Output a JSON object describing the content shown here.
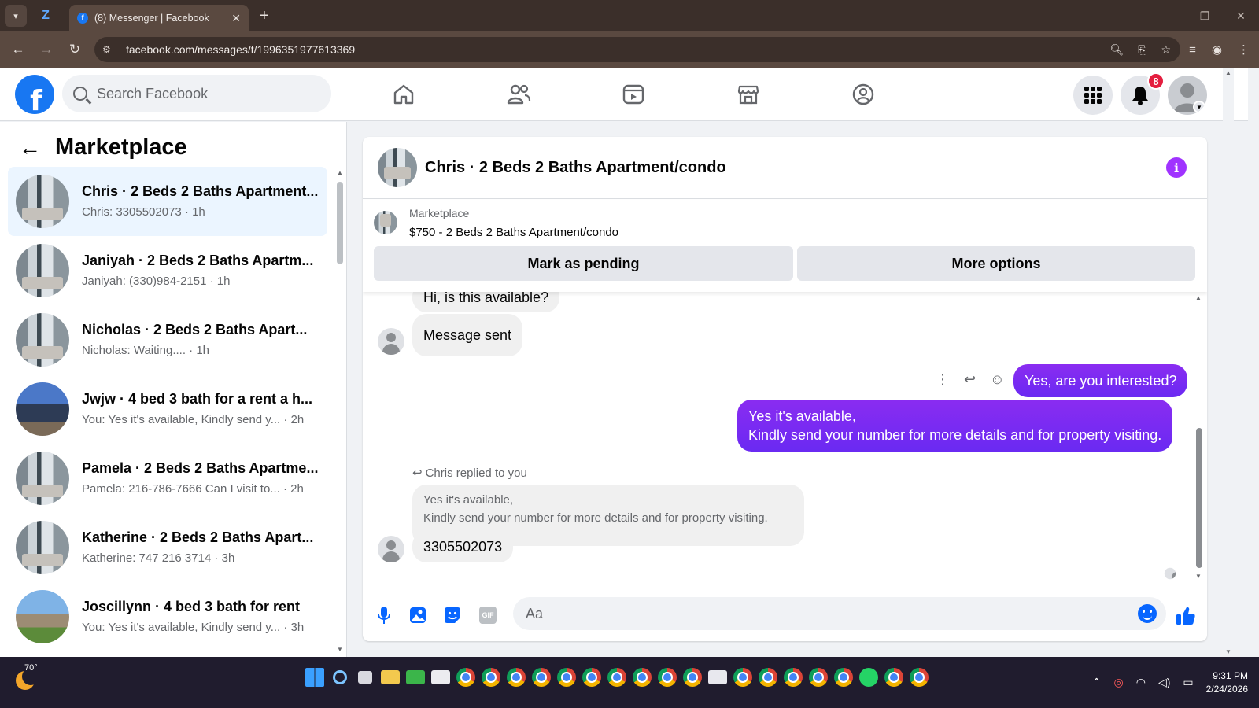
{
  "browser": {
    "tab_title": "(8) Messenger | Facebook",
    "url": "facebook.com/messages/t/1996351977613369"
  },
  "header": {
    "search_placeholder": "Search Facebook",
    "notification_count": "8"
  },
  "sidebar": {
    "title": "Marketplace",
    "conversations": [
      {
        "name": "Chris · 2 Beds 2 Baths Apartment...",
        "preview": "Chris: 3305502073 · 1h",
        "thumb": "room",
        "active": true
      },
      {
        "name": "Janiyah · 2 Beds 2 Baths Apartm...",
        "preview": "Janiyah: (330)984-2151 · 1h",
        "thumb": "room"
      },
      {
        "name": "Nicholas · 2 Beds 2 Baths Apart...",
        "preview": "Nicholas: Waiting.... · 1h",
        "thumb": "room"
      },
      {
        "name": "Jwjw · 4 bed 3 bath for a rent a h...",
        "preview": "You: Yes it's available, Kindly send y...  · 2h",
        "thumb": "house1"
      },
      {
        "name": "Pamela · 2 Beds 2 Baths Apartme...",
        "preview": "Pamela: 216-786-7666 Can I visit to... · 2h",
        "thumb": "room"
      },
      {
        "name": "Katherine · 2 Beds 2 Baths Apart...",
        "preview": "Katherine: 747 216 3714 · 3h",
        "thumb": "room"
      },
      {
        "name": "Joscillynn · 4 bed 3 bath for rent",
        "preview": "You: Yes it's available, Kindly send y...  · 3h",
        "thumb": "house2"
      }
    ]
  },
  "chat": {
    "title": "Chris · 2 Beds 2 Baths Apartment/condo",
    "listing_label": "Marketplace",
    "listing_title": "$750 - 2 Beds 2 Baths Apartment/condo",
    "mark_pending_label": "Mark as pending",
    "more_options_label": "More options",
    "messages": {
      "in_partial": "Hi, is this available?",
      "in_sent": "Message sent",
      "out_1": "Yes, are you interested?",
      "out_2_line1": "Yes it's available,",
      "out_2_line2": "Kindly send your number for more details and for property visiting.",
      "replied_label": "Chris replied to you",
      "quoted_line1": "Yes it's available,",
      "quoted_line2": "Kindly send your number for more details and for property visiting.",
      "in_number": "3305502073"
    },
    "composer_placeholder": "Aa",
    "gif_label": "GIF"
  },
  "taskbar": {
    "temperature": "70°",
    "time": "9:31 PM",
    "date": "2/24/2026"
  },
  "colors": {
    "facebook_blue": "#1877f2",
    "messenger_purple": "#7a1ff5",
    "active_row": "#ebf5ff",
    "badge_red": "#e41e3f"
  }
}
